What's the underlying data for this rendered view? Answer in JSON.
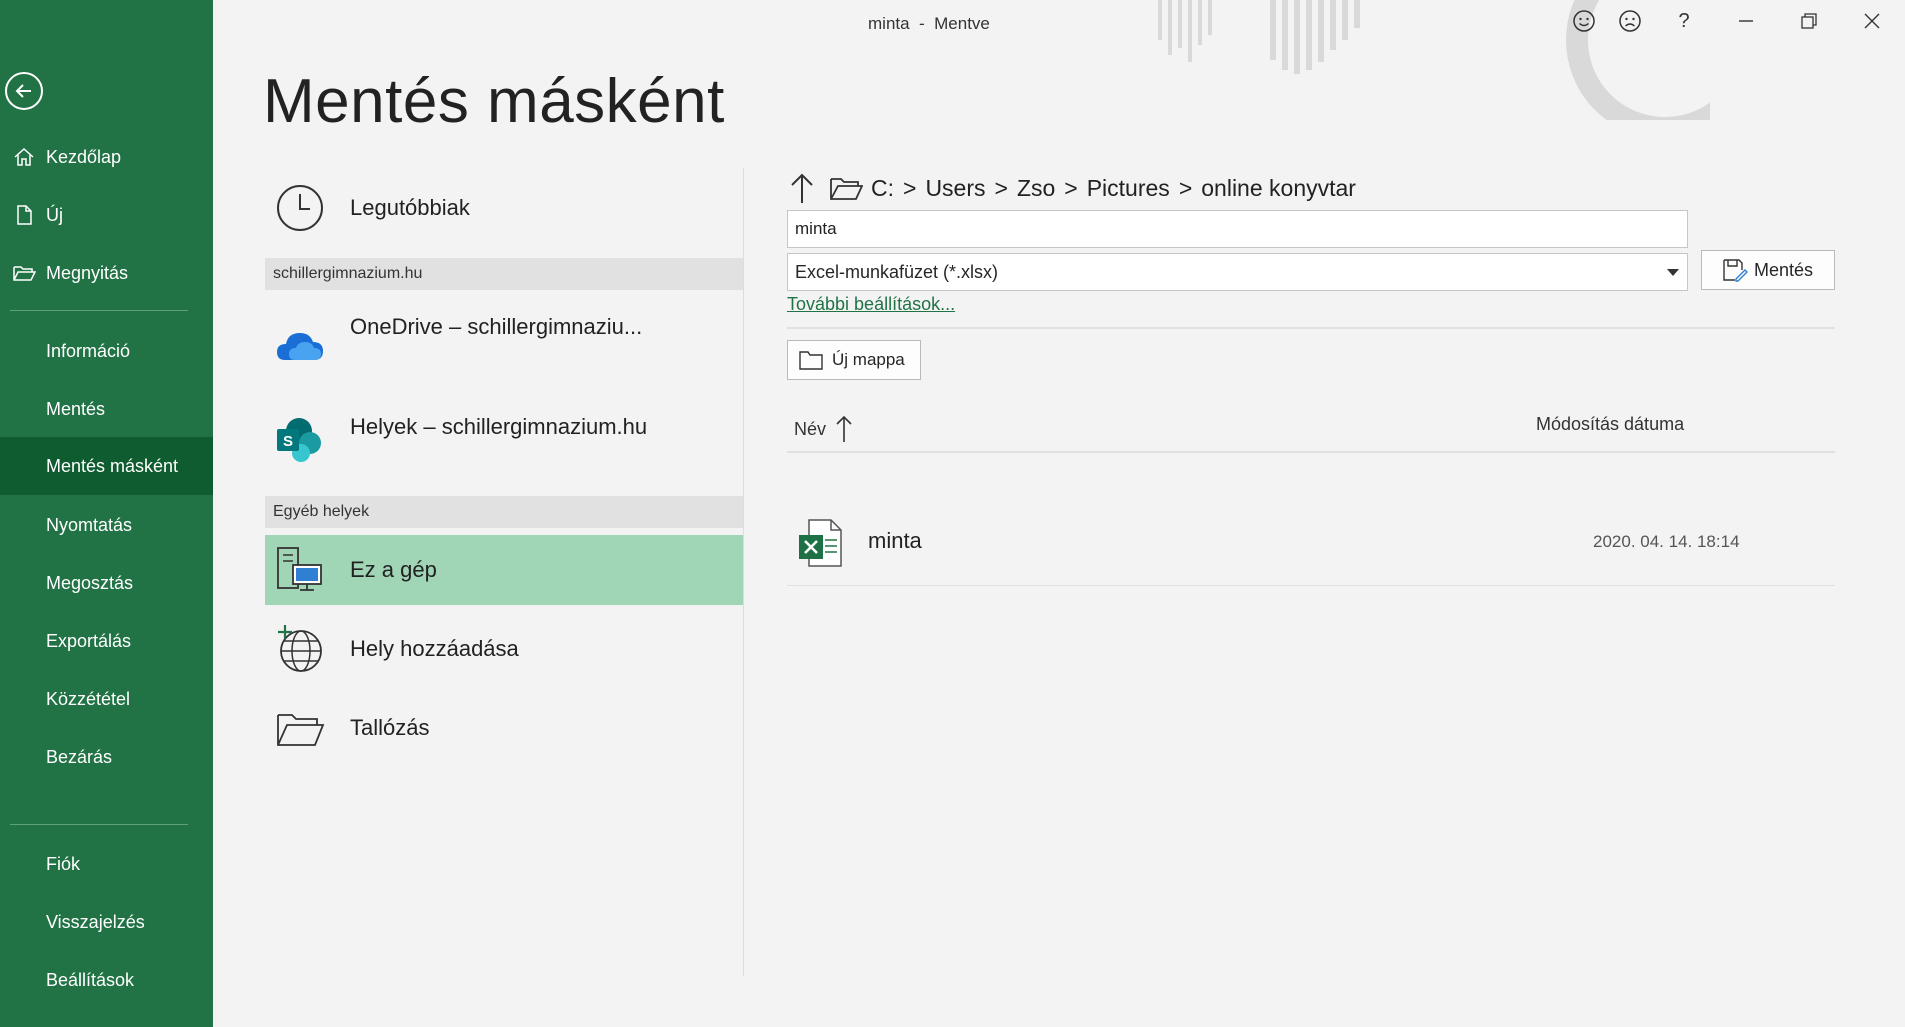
{
  "window": {
    "title": "minta  -  Mentve"
  },
  "title_bar": {
    "buttons": [
      "smiley-icon",
      "frown-icon",
      "help-icon",
      "minimize-icon",
      "restore-icon",
      "close-icon"
    ],
    "help_label": "?"
  },
  "sidebar": {
    "bg": "#217346",
    "items": [
      {
        "label": "Kezdőlap",
        "icon": "home-icon"
      },
      {
        "label": "Új",
        "icon": "new-doc-icon"
      },
      {
        "label": "Megnyitás",
        "icon": "open-folder-icon"
      },
      {
        "label": "Információ"
      },
      {
        "label": "Mentés"
      },
      {
        "label": "Mentés másként",
        "active": true
      },
      {
        "label": "Nyomtatás"
      },
      {
        "label": "Megosztás"
      },
      {
        "label": "Exportálás"
      },
      {
        "label": "Közzététel"
      },
      {
        "label": "Bezárás"
      },
      {
        "label": "Fiók"
      },
      {
        "label": "Visszajelzés"
      },
      {
        "label": "Beállítások"
      }
    ]
  },
  "page": {
    "title": "Mentés másként"
  },
  "locations": {
    "recent": "Legutóbbiak",
    "group1_header": "schillergimnazium.hu",
    "onedrive": "OneDrive – schillergimnaziu...",
    "sites": "Helyek – schillergimnazium.hu",
    "group2_header": "Egyéb helyek",
    "this_pc": "Ez a gép",
    "add_place": "Hely hozzáadása",
    "browse": "Tallózás",
    "selected_bg": "#a0d5b5"
  },
  "path": {
    "parts": [
      "C:",
      "Users",
      "Zso",
      "Pictures",
      "online konyvtar"
    ],
    "separator": ">"
  },
  "form": {
    "filename": "minta",
    "filetype": "Excel-munkafüzet (*.xlsx)",
    "save_label": "Mentés",
    "more_options": "További beállítások...",
    "new_folder": "Új mappa"
  },
  "file_list": {
    "col_name": "Név",
    "col_date": "Módosítás dátuma",
    "files": [
      {
        "name": "minta",
        "modified": "2020. 04. 14. 18:14",
        "icon": "excel-file-icon"
      }
    ]
  }
}
